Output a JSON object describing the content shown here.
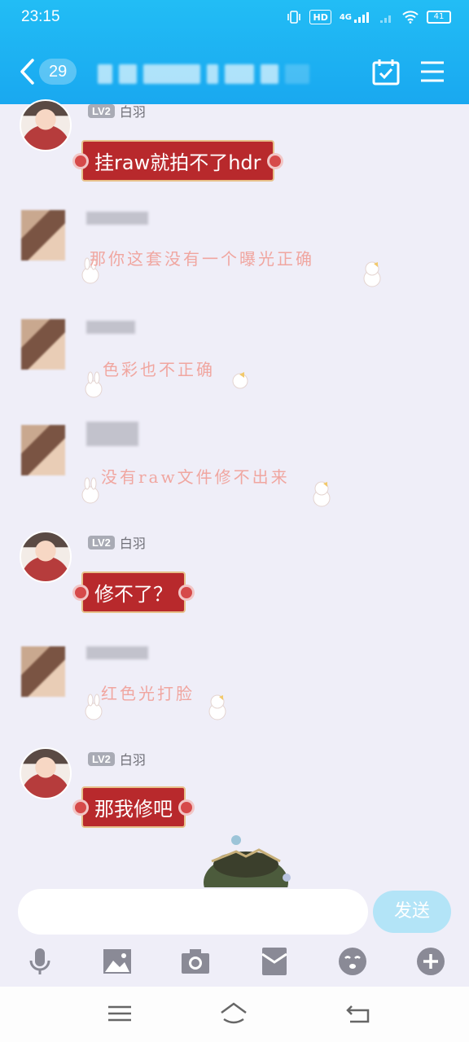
{
  "status": {
    "time": "23:15",
    "hd": "HD",
    "net": "4G",
    "battery": "41"
  },
  "header": {
    "unread_count": "29"
  },
  "messages": [
    {
      "sender": "me",
      "level": "LV2",
      "name": "白羽",
      "text": "挂raw就拍不了hdr"
    },
    {
      "sender": "other",
      "text": "那你这套没有一个曝光正确"
    },
    {
      "sender": "other",
      "text": "色彩也不正确"
    },
    {
      "sender": "other",
      "text": "没有raw文件修不出来"
    },
    {
      "sender": "me",
      "level": "LV2",
      "name": "白羽",
      "text": "修不了？"
    },
    {
      "sender": "other",
      "text": "红色光打脸"
    },
    {
      "sender": "me",
      "level": "LV2",
      "name": "白羽",
      "text": "那我修吧"
    }
  ],
  "composer": {
    "send_label": "发送"
  },
  "toolbar": [
    "mic-icon",
    "image-icon",
    "camera-icon",
    "red-packet-icon",
    "emoji-icon",
    "plus-icon"
  ],
  "colors": {
    "header": "#1fb4f3",
    "bubble_red": "#b8292c",
    "pink_text": "#f0a6a0"
  }
}
